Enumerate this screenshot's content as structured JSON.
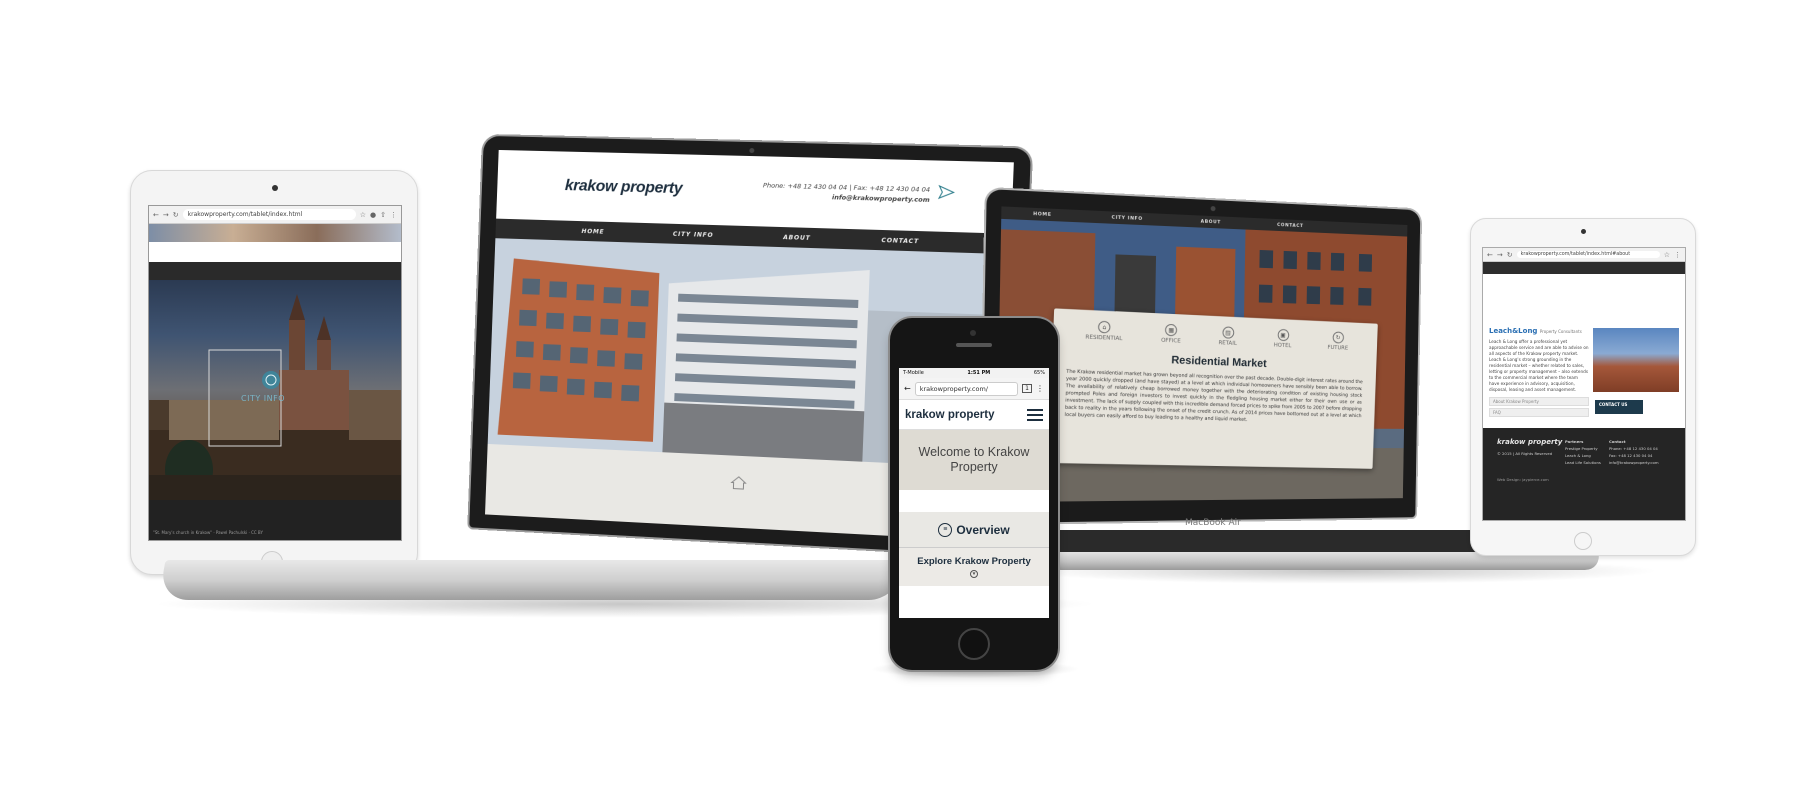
{
  "tablet_left": {
    "url": "krakowproperty.com/tablet/index.html",
    "hero_label": "CITY INFO",
    "caption": "\"St. Mary's church in Krakow\" · Pawel Pachulski · CC BY"
  },
  "laptop": {
    "logo": "krakow property",
    "phone": "Phone: +48 12 430 04 04",
    "fax": "Fax: +48 12 430 04 04",
    "email": "info@krakowproperty.com",
    "nav": [
      "HOME",
      "CITY INFO",
      "ABOUT",
      "CONTACT"
    ]
  },
  "macbook_air": {
    "nav": [
      "HOME",
      "CITY INFO",
      "ABOUT",
      "CONTACT"
    ],
    "tabs": [
      "RESIDENTIAL",
      "OFFICE",
      "RETAIL",
      "HOTEL",
      "FUTURE"
    ],
    "card_title": "Residential Market",
    "card_text": "The Krakow residential market has grown beyond all recognition over the past decade. Double-digit interest rates around the year 2000 quickly dropped (and have stayed) at a level at which individual homeowners have sensibly been able to borrow. The availability of relatively cheap borrowed money together with the deteriorating condition of existing housing stock prompted Poles and foreign investors to invest quickly in the fledgling housing market either for their own use or as investment. The lack of supply coupled with this incredible demand forced prices to spike from 2005 to 2007 before dropping back to reality in the years following the onset of the credit crunch. As of 2014 prices have bottomed out at a level at which local buyers can easily afford to buy leading to a healthy and liquid market.",
    "brand_label": "MacBook Air"
  },
  "tablet_right": {
    "url": "krakowproperty.com/tablet/index.html#about",
    "partner_logo": "Leach&Long",
    "partner_sub": "Property Consultants",
    "about_text": "Leach & Long offer a professional yet approachable service and are able to advise on all aspects of the Krakow property market. Leach & Long's strong grounding in the residential market – whether related to sales, letting or property management – also extends to the commercial market where the team have experience in advisory, acquisition, disposal, leasing and asset management.",
    "field_name": "About Krakow Property",
    "field_faq": "FAQ",
    "contact_button": "CONTACT US",
    "footer_logo": "krakow property",
    "footer_copy": "© 2015 | All Rights Reserved",
    "partners_title": "Partners",
    "partners": [
      "Prestige Property",
      "Leach & Long",
      "Lead Life Solutions"
    ],
    "contact_title": "Contact",
    "contact_lines": [
      "Phone: +48 12 430 04 04",
      "Fax: +48 12 430 04 04",
      "info@krakowproperty.com"
    ],
    "design_credit": "Web Design: jaypierce.com"
  },
  "phone": {
    "carrier": "T-Mobile",
    "time": "1:51 PM",
    "battery": "65%",
    "url": "krakowproperty.com/",
    "tab_count": "1",
    "logo": "krakow property",
    "welcome": "Welcome to Krakow Property",
    "overview": "Overview",
    "explore": "Explore Krakow Property"
  },
  "colors": {
    "brand_navy": "#1d2e3e",
    "nav_dark": "#2b2b2b",
    "beige": "#dedbd3"
  }
}
